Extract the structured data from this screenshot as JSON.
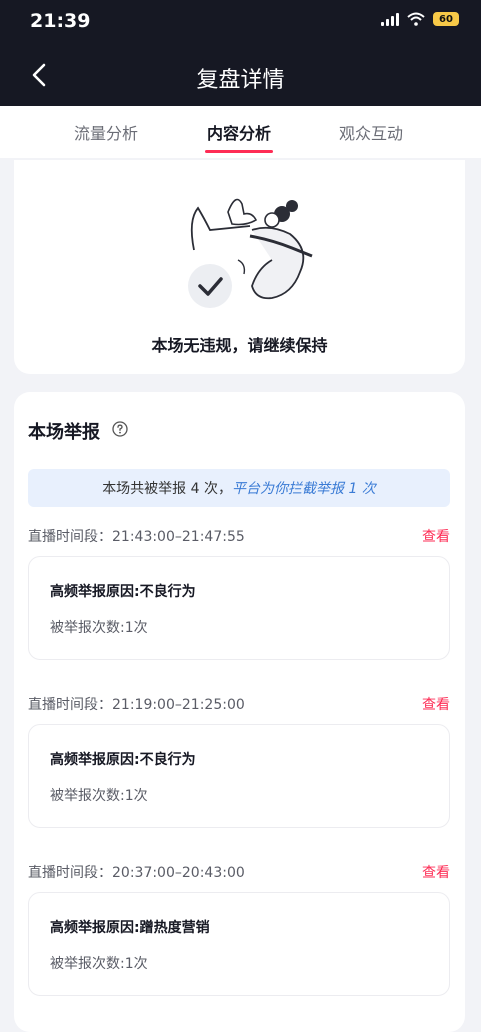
{
  "status": {
    "time": "21:39",
    "battery": "60"
  },
  "nav": {
    "title": "复盘详情"
  },
  "tabs": [
    {
      "label": "流量分析",
      "active": false
    },
    {
      "label": "内容分析",
      "active": true
    },
    {
      "label": "观众互动",
      "active": false
    }
  ],
  "compliance": {
    "message": "本场无违规，请继续保持"
  },
  "reports": {
    "title": "本场举报",
    "banner": {
      "count_text": "本场共被举报 4 次，",
      "intercepted_text": "平台为你拦截举报 1 次"
    },
    "view_label": "查看",
    "items": [
      {
        "period": "直播时间段：21:43:00–21:47:55",
        "reason": "高频举报原因:不良行为",
        "times": "被举报次数:1次"
      },
      {
        "period": "直播时间段：21:19:00–21:25:00",
        "reason": "高频举报原因:不良行为",
        "times": "被举报次数:1次"
      },
      {
        "period": "直播时间段：20:37:00–20:43:00",
        "reason": "高频举报原因:蹭热度营销",
        "times": "被举报次数:1次"
      }
    ]
  },
  "colors": {
    "accent": "#fe2c55",
    "link_blue": "#3a7bd5",
    "header_bg": "#161823"
  }
}
